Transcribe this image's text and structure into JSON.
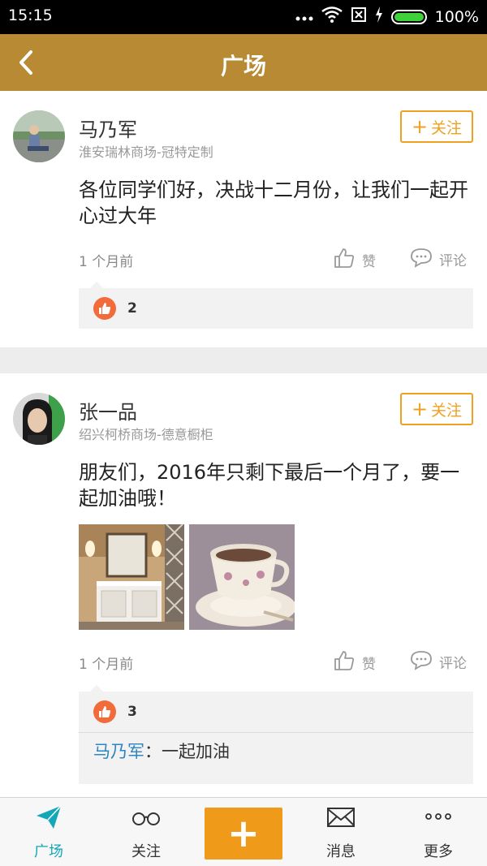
{
  "status_bar": {
    "time": "15:15",
    "battery_text": "100%",
    "colors": {
      "battery": "#3fd13a"
    }
  },
  "header": {
    "title": "广场",
    "back_icon": "chevron-left-icon",
    "background": "#b88a33"
  },
  "posts": [
    {
      "author": "马乃军",
      "store": "淮安瑞林商场-冠特定制",
      "follow_plus": "+",
      "follow_label": "关注",
      "text": "各位同学们好，决战十二月份，让我们一起开心过大年",
      "time_ago": "1 个月前",
      "like_label": "赞",
      "comment_label": "评论",
      "like_count": "2",
      "comments": []
    },
    {
      "author": "张一品",
      "store": "绍兴柯桥商场-德意橱柜",
      "follow_plus": "+",
      "follow_label": "关注",
      "text": "朋友们，2016年只剩下最后一个月了，要一起加油哦！",
      "time_ago": "1 个月前",
      "like_label": "赞",
      "comment_label": "评论",
      "like_count": "3",
      "comments": [
        {
          "author": "马乃军",
          "separator": "：",
          "text": "一起加油"
        }
      ],
      "photos": [
        "bathroom-vanity-photo",
        "teacup-photo"
      ]
    }
  ],
  "bottom_nav": {
    "tabs": [
      {
        "label": "广场",
        "icon": "paper-plane-icon",
        "active": true
      },
      {
        "label": "关注",
        "icon": "glasses-icon",
        "active": false
      },
      {
        "label": "消息",
        "icon": "envelope-icon",
        "active": false
      },
      {
        "label": "更多",
        "icon": "more-dots-icon",
        "active": false
      }
    ],
    "add_label": "+",
    "colors": {
      "active": "#13a7b8",
      "add_button": "#f09a1a"
    }
  },
  "colors": {
    "accent": "#f0a020",
    "like_badge": "#f26b3a",
    "comment_author": "#2e86c1"
  }
}
